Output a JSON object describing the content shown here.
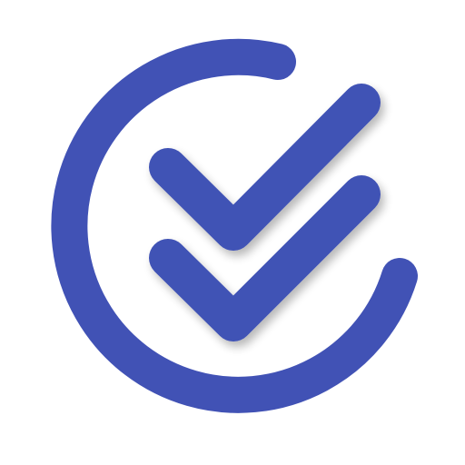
{
  "logo": {
    "icon_name": "double-check-circle-icon",
    "primary_color": "#4152B5",
    "background_color": "#ffffff"
  }
}
